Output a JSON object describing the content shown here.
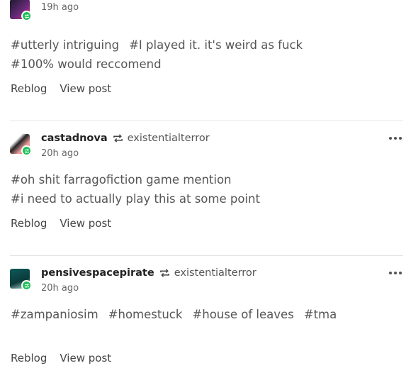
{
  "notes": [
    {
      "username": "",
      "source": "",
      "time": "19h ago",
      "tag_rows": [
        [
          "#utterly intriguing",
          "#I played it. it's weird as fuck"
        ],
        [
          "#100% would reccomend"
        ]
      ],
      "reblog_label": "Reblog",
      "view_label": "View post"
    },
    {
      "username": "castadnova",
      "source": "existentialterror",
      "time": "20h ago",
      "tag_rows": [
        [
          "#oh shit farragofiction game mention"
        ],
        [
          "#i need to actually play this at some point"
        ]
      ],
      "reblog_label": "Reblog",
      "view_label": "View post"
    },
    {
      "username": "pensivespacepirate",
      "source": "existentialterror",
      "time": "20h ago",
      "tag_rows": [
        [
          "#zampaniosim",
          "#homestuck",
          "#house of leaves",
          "#tma"
        ]
      ],
      "reblog_label": "Reblog",
      "view_label": "View post"
    }
  ],
  "colors": {
    "badge": "#20c05a",
    "divider": "#e3e3e3"
  }
}
